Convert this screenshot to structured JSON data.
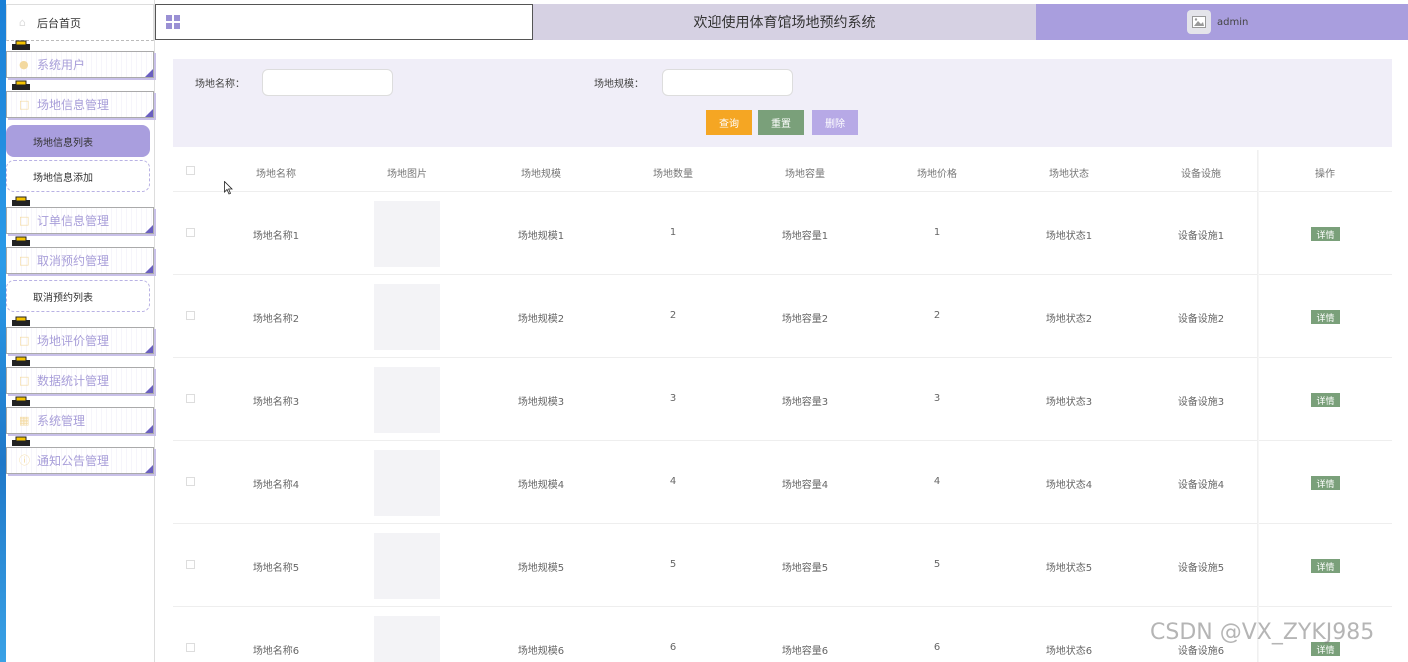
{
  "sidebar": {
    "home": "后台首页",
    "items": [
      {
        "label": "系统用户"
      },
      {
        "label": "场地信息管理"
      },
      {
        "label": "订单信息管理"
      },
      {
        "label": "取消预约管理"
      },
      {
        "label": "场地评价管理"
      },
      {
        "label": "数据统计管理"
      },
      {
        "label": "系统管理"
      },
      {
        "label": "通知公告管理"
      }
    ],
    "subitems": [
      {
        "label": "场地信息列表"
      },
      {
        "label": "场地信息添加"
      },
      {
        "label": "取消预约列表"
      }
    ]
  },
  "header": {
    "title": "欢迎使用体育馆场地预约系统",
    "user": "admin"
  },
  "search": {
    "name_label": "场地名称：",
    "scale_label": "场地规模：",
    "name_value": "",
    "scale_value": "",
    "query_btn": "查询",
    "reset_btn": "重置",
    "delete_btn": "删除"
  },
  "table": {
    "headers": [
      "场地名称",
      "场地图片",
      "场地规模",
      "场地数量",
      "场地容量",
      "场地价格",
      "场地状态",
      "设备设施",
      "操作"
    ],
    "detail_label": "详情",
    "rows": [
      {
        "name": "场地名称1",
        "scale": "场地规模1",
        "count": "1",
        "capacity": "场地容量1",
        "price": "1",
        "status": "场地状态1",
        "facility": "设备设施1"
      },
      {
        "name": "场地名称2",
        "scale": "场地规模2",
        "count": "2",
        "capacity": "场地容量2",
        "price": "2",
        "status": "场地状态2",
        "facility": "设备设施2"
      },
      {
        "name": "场地名称3",
        "scale": "场地规模3",
        "count": "3",
        "capacity": "场地容量3",
        "price": "3",
        "status": "场地状态3",
        "facility": "设备设施3"
      },
      {
        "name": "场地名称4",
        "scale": "场地规模4",
        "count": "4",
        "capacity": "场地容量4",
        "price": "4",
        "status": "场地状态4",
        "facility": "设备设施4"
      },
      {
        "name": "场地名称5",
        "scale": "场地规模5",
        "count": "5",
        "capacity": "场地容量5",
        "price": "5",
        "status": "场地状态5",
        "facility": "设备设施5"
      },
      {
        "name": "场地名称6",
        "scale": "场地规模6",
        "count": "6",
        "capacity": "场地容量6",
        "price": "6",
        "status": "场地状态6",
        "facility": "设备设施6"
      }
    ]
  },
  "watermark": "CSDN @VX_ZYKJ985",
  "colors": {
    "accent": "#a99ede",
    "query": "#f5a623",
    "reset": "#7aa07a",
    "delete": "#b7a9e6",
    "header_title_bg": "#d6d1e3"
  },
  "icons": {
    "home": "home-icon",
    "menu": "menu-grid-icon",
    "avatar": "image-icon"
  }
}
